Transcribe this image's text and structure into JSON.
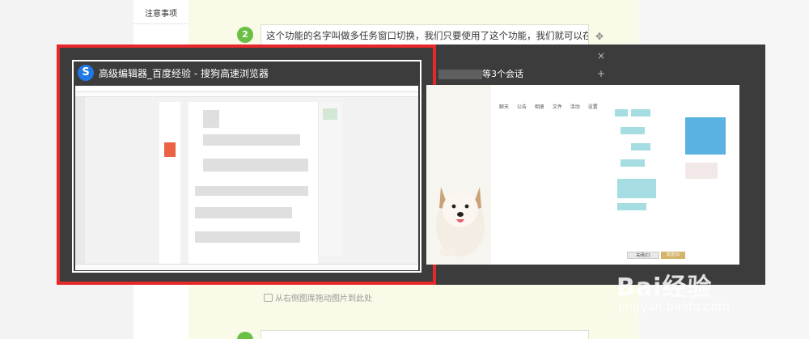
{
  "left_nav": {
    "item": "注意事项"
  },
  "step": {
    "number_top": "2",
    "text": "这个功能的名字叫做多任务窗口切换，我们只要使用了这个功能，我们就可以在",
    "number_bottom": ""
  },
  "tools": {
    "move": "✥",
    "close": "×",
    "add": "+"
  },
  "hint": {
    "text": "从右侧图库拖动图片到此处"
  },
  "switcher": {
    "window1": {
      "title": "高级编辑器_百度经验 - 搜狗高速浏览器",
      "logo": "S"
    },
    "window2": {
      "title": "等3个会话",
      "tabs": [
        "聊天",
        "公告",
        "相册",
        "文件",
        "活动",
        "设置"
      ],
      "close_button": "关闭(C)",
      "send_button": "发送(S)"
    }
  },
  "watermark": {
    "main": "Bai经验",
    "sub": "jingyan.baidu.com"
  },
  "colors": {
    "frame_red": "#e6282a",
    "badge_green": "#6ac044",
    "switcher_bg": "#3c3c3c",
    "tile_cyan": "#a5dde2"
  }
}
